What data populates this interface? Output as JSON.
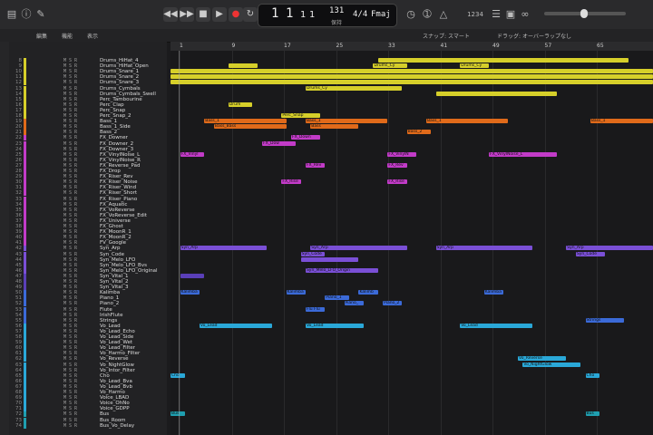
{
  "transport": {
    "bar": "1",
    "beat": "1",
    "div": "1",
    "tick": "1",
    "tempo": "131",
    "tempo_label": "保持",
    "sig": "4/4",
    "key": "Fmaj",
    "lcd_labels": [
      "小節",
      "拍",
      "",
      "",
      "",
      "テンポ",
      "",
      ""
    ],
    "cpu": "1234"
  },
  "toolbar2": {
    "edit": "編集",
    "func": "機能",
    "view": "表示",
    "snap_label": "スナップ:",
    "snap_value": "スマート",
    "drag_label": "ドラッグ:",
    "drag_value": "オーバーラップなし"
  },
  "ruler": [
    "1",
    "9",
    "17",
    "25",
    "33",
    "41",
    "49",
    "57",
    "65"
  ],
  "colors": {
    "yellow": "#d6cf2a",
    "orange": "#e06a1a",
    "magenta": "#c23bc8",
    "purple": "#7a4fd6",
    "violet": "#5a3fb8",
    "blue": "#3b6ad8",
    "cyan": "#2aa8d8",
    "teal": "#1f9fb0"
  },
  "tracks": [
    {
      "n": "8",
      "name": "Drums_HiHat_4",
      "c": "yellow"
    },
    {
      "n": "9",
      "name": "Drums_HiHat_Open",
      "c": "yellow"
    },
    {
      "n": "10",
      "name": "Drums_Snare_1",
      "c": "yellow"
    },
    {
      "n": "11",
      "name": "Drums_Snare_2",
      "c": "yellow"
    },
    {
      "n": "12",
      "name": "Drums_Snare_3",
      "c": "yellow"
    },
    {
      "n": "13",
      "name": "Drums_Cymbals",
      "c": "yellow"
    },
    {
      "n": "14",
      "name": "Drums_Cymbals_Swell",
      "c": "yellow"
    },
    {
      "n": "15",
      "name": "Perc_Tambourine",
      "c": "yellow"
    },
    {
      "n": "16",
      "name": "Perc_Clap",
      "c": "yellow"
    },
    {
      "n": "17",
      "name": "Perc_Snap",
      "c": "yellow"
    },
    {
      "n": "18",
      "name": "Perc_Snap_2",
      "c": "yellow"
    },
    {
      "n": "19",
      "name": "Bass_1",
      "c": "orange"
    },
    {
      "n": "20",
      "name": "Bass_1_Side",
      "c": "orange"
    },
    {
      "n": "21",
      "name": "Bass_2",
      "c": "orange"
    },
    {
      "n": "22",
      "name": "FX_Downer",
      "c": "magenta"
    },
    {
      "n": "23",
      "name": "FX_Downer_2",
      "c": "magenta"
    },
    {
      "n": "24",
      "name": "FX_Downer_3",
      "c": "magenta"
    },
    {
      "n": "25",
      "name": "FX_VinylNoise_L",
      "c": "magenta"
    },
    {
      "n": "26",
      "name": "FX_VinylNoise_R",
      "c": "magenta"
    },
    {
      "n": "27",
      "name": "FX_Reverse_Pad",
      "c": "magenta"
    },
    {
      "n": "28",
      "name": "FX_Drop",
      "c": "magenta"
    },
    {
      "n": "29",
      "name": "FX_Riser_Rev",
      "c": "magenta"
    },
    {
      "n": "30",
      "name": "FX_Riser_Noise",
      "c": "magenta"
    },
    {
      "n": "31",
      "name": "FX_Riser_Wind",
      "c": "magenta"
    },
    {
      "n": "32",
      "name": "FX_Riser_Short",
      "c": "magenta"
    },
    {
      "n": "33",
      "name": "FX_Riser_Piano",
      "c": "magenta"
    },
    {
      "n": "34",
      "name": "FX_Aquatic",
      "c": "magenta"
    },
    {
      "n": "35",
      "name": "FX_VoReverse",
      "c": "magenta"
    },
    {
      "n": "36",
      "name": "FX_VoReverse_Edit",
      "c": "magenta"
    },
    {
      "n": "37",
      "name": "FX_Universe",
      "c": "magenta"
    },
    {
      "n": "38",
      "name": "FX_Ghost",
      "c": "magenta"
    },
    {
      "n": "39",
      "name": "FX_MoonR_1",
      "c": "magenta"
    },
    {
      "n": "40",
      "name": "FX_MoonR_2",
      "c": "magenta"
    },
    {
      "n": "41",
      "name": "FV_Google",
      "c": "magenta"
    },
    {
      "n": "42",
      "name": "Syn_Arp",
      "c": "purple"
    },
    {
      "n": "43",
      "name": "Syn_Code",
      "c": "purple"
    },
    {
      "n": "44",
      "name": "Syn_Melo_LFO",
      "c": "purple"
    },
    {
      "n": "45",
      "name": "Syn_Melo_LFO_Bvs",
      "c": "purple"
    },
    {
      "n": "46",
      "name": "Syn_Melo_LFO_Original",
      "c": "purple"
    },
    {
      "n": "47",
      "name": "Syn_Vital_1",
      "c": "violet"
    },
    {
      "n": "48",
      "name": "Syn_Vital_2",
      "c": "violet"
    },
    {
      "n": "49",
      "name": "Syn_Vital_3",
      "c": "violet"
    },
    {
      "n": "50",
      "name": "Kalimba",
      "c": "blue"
    },
    {
      "n": "51",
      "name": "Piano_1",
      "c": "blue"
    },
    {
      "n": "52",
      "name": "Piano_2",
      "c": "blue"
    },
    {
      "n": "53",
      "name": "Flute",
      "c": "blue"
    },
    {
      "n": "54",
      "name": "IrishFlute",
      "c": "blue"
    },
    {
      "n": "55",
      "name": "Strings",
      "c": "blue"
    },
    {
      "n": "56",
      "name": "Vo_Lead",
      "c": "cyan"
    },
    {
      "n": "57",
      "name": "Vo_Lead_Echo",
      "c": "cyan"
    },
    {
      "n": "58",
      "name": "Vo_Lead_Side",
      "c": "cyan"
    },
    {
      "n": "59",
      "name": "Vo_Lead_Wet",
      "c": "cyan"
    },
    {
      "n": "60",
      "name": "Vo_Lead_Filter",
      "c": "cyan"
    },
    {
      "n": "61",
      "name": "Vo_Harmo_Filter",
      "c": "cyan"
    },
    {
      "n": "62",
      "name": "Vo_Reverse",
      "c": "cyan"
    },
    {
      "n": "63",
      "name": "Vo_NightGlow",
      "c": "cyan"
    },
    {
      "n": "64",
      "name": "Vo_Intor_Filter",
      "c": "cyan"
    },
    {
      "n": "65",
      "name": "Cho",
      "c": "cyan"
    },
    {
      "n": "66",
      "name": "Vo_Lead_Bva",
      "c": "cyan"
    },
    {
      "n": "67",
      "name": "Vo_Lead_Bvb",
      "c": "cyan"
    },
    {
      "n": "68",
      "name": "Vo_Harmo",
      "c": "cyan"
    },
    {
      "n": "69",
      "name": "Voice_LBAD",
      "c": "cyan"
    },
    {
      "n": "70",
      "name": "Voice_OhNo",
      "c": "cyan"
    },
    {
      "n": "71",
      "name": "Voice_GDPP",
      "c": "cyan"
    },
    {
      "n": "72",
      "name": "Bus",
      "c": "teal"
    },
    {
      "n": "73",
      "name": "Bus_Room",
      "c": "teal"
    },
    {
      "n": "74",
      "name": "Bus_Vo_Delay",
      "c": "teal"
    }
  ],
  "regions": [
    {
      "t": 0,
      "x": 0.43,
      "w": 0.52,
      "c": "yellow",
      "l": ""
    },
    {
      "t": 1,
      "x": 0.12,
      "w": 0.06,
      "c": "yellow",
      "l": ""
    },
    {
      "t": 1,
      "x": 0.42,
      "w": 0.07,
      "c": "yellow",
      "l": "Drums_Cy"
    },
    {
      "t": 1,
      "x": 0.6,
      "w": 0.06,
      "c": "yellow",
      "l": "Drums_Cy"
    },
    {
      "t": 2,
      "x": 0.0,
      "w": 1.0,
      "c": "yellow",
      "l": ""
    },
    {
      "t": 3,
      "x": 0.0,
      "w": 1.0,
      "c": "yellow",
      "l": ""
    },
    {
      "t": 4,
      "x": 0.0,
      "w": 1.0,
      "c": "yellow",
      "l": ""
    },
    {
      "t": 5,
      "x": 0.28,
      "w": 0.2,
      "c": "yellow",
      "l": "Drums_Cy"
    },
    {
      "t": 6,
      "x": 0.55,
      "w": 0.25,
      "c": "yellow",
      "l": ""
    },
    {
      "t": 8,
      "x": 0.12,
      "w": 0.05,
      "c": "yellow",
      "l": "Drum"
    },
    {
      "t": 10,
      "x": 0.23,
      "w": 0.08,
      "c": "yellow",
      "l": "Perc_Snap"
    },
    {
      "t": 11,
      "x": 0.07,
      "w": 0.17,
      "c": "orange",
      "l": "Bass_1"
    },
    {
      "t": 11,
      "x": 0.28,
      "w": 0.17,
      "c": "orange",
      "l": "Bass_1"
    },
    {
      "t": 11,
      "x": 0.53,
      "w": 0.17,
      "c": "orange",
      "l": "Bass_1"
    },
    {
      "t": 11,
      "x": 0.87,
      "w": 0.13,
      "c": "orange",
      "l": "Bass_1"
    },
    {
      "t": 12,
      "x": 0.09,
      "w": 0.15,
      "c": "orange",
      "l": "Bass_Bass"
    },
    {
      "t": 12,
      "x": 0.29,
      "w": 0.1,
      "c": "orange",
      "l": "Bass"
    },
    {
      "t": 13,
      "x": 0.49,
      "w": 0.05,
      "c": "orange",
      "l": "Bass_2"
    },
    {
      "t": 14,
      "x": 0.25,
      "w": 0.06,
      "c": "magenta",
      "l": "FX_Down"
    },
    {
      "t": 15,
      "x": 0.19,
      "w": 0.07,
      "c": "magenta",
      "l": "FX_Dow"
    },
    {
      "t": 17,
      "x": 0.02,
      "w": 0.05,
      "c": "magenta",
      "l": "FX_Vinyl"
    },
    {
      "t": 17,
      "x": 0.45,
      "w": 0.06,
      "c": "magenta",
      "l": "FX_VinylN"
    },
    {
      "t": 17,
      "x": 0.66,
      "w": 0.14,
      "c": "magenta",
      "l": "FX_VinylNoise_L"
    },
    {
      "t": 19,
      "x": 0.28,
      "w": 0.04,
      "c": "magenta",
      "l": "FX_Rev"
    },
    {
      "t": 19,
      "x": 0.45,
      "w": 0.04,
      "c": "magenta",
      "l": "FX_Rev"
    },
    {
      "t": 22,
      "x": 0.23,
      "w": 0.04,
      "c": "magenta",
      "l": "FX_Rise"
    },
    {
      "t": 22,
      "x": 0.45,
      "w": 0.04,
      "c": "magenta",
      "l": "FX_Rise"
    },
    {
      "t": 34,
      "x": 0.02,
      "w": 0.18,
      "c": "purple",
      "l": "Syn_Arp"
    },
    {
      "t": 34,
      "x": 0.29,
      "w": 0.2,
      "c": "purple",
      "l": "Syn_Arp"
    },
    {
      "t": 34,
      "x": 0.55,
      "w": 0.2,
      "c": "purple",
      "l": "Syn_Arp"
    },
    {
      "t": 34,
      "x": 0.82,
      "w": 0.18,
      "c": "purple",
      "l": "Syn_Arp"
    },
    {
      "t": 35,
      "x": 0.27,
      "w": 0.05,
      "c": "purple",
      "l": "Syn_Code"
    },
    {
      "t": 35,
      "x": 0.84,
      "w": 0.06,
      "c": "purple",
      "l": "Syn_Code"
    },
    {
      "t": 36,
      "x": 0.27,
      "w": 0.12,
      "c": "purple",
      "l": ""
    },
    {
      "t": 38,
      "x": 0.28,
      "w": 0.15,
      "c": "purple",
      "l": "Syn_Melo_LFO_Origin"
    },
    {
      "t": 39,
      "x": 0.02,
      "w": 0.05,
      "c": "violet",
      "l": ""
    },
    {
      "t": 42,
      "x": 0.02,
      "w": 0.04,
      "c": "blue",
      "l": "Kalimba"
    },
    {
      "t": 42,
      "x": 0.24,
      "w": 0.04,
      "c": "blue",
      "l": "Kalimba"
    },
    {
      "t": 42,
      "x": 0.39,
      "w": 0.04,
      "c": "blue",
      "l": "Kalimb"
    },
    {
      "t": 42,
      "x": 0.65,
      "w": 0.04,
      "c": "blue",
      "l": "Kalimba"
    },
    {
      "t": 43,
      "x": 0.32,
      "w": 0.05,
      "c": "blue",
      "l": "Piano_1"
    },
    {
      "t": 44,
      "x": 0.36,
      "w": 0.04,
      "c": "blue",
      "l": "Piano_"
    },
    {
      "t": 44,
      "x": 0.44,
      "w": 0.04,
      "c": "blue",
      "l": "Piano_2"
    },
    {
      "t": 45,
      "x": 0.28,
      "w": 0.04,
      "c": "blue",
      "l": "Flu Flu"
    },
    {
      "t": 47,
      "x": 0.86,
      "w": 0.08,
      "c": "blue",
      "l": "Strings"
    },
    {
      "t": 48,
      "x": 0.06,
      "w": 0.15,
      "c": "cyan",
      "l": "Vo_Lead"
    },
    {
      "t": 48,
      "x": 0.28,
      "w": 0.12,
      "c": "cyan",
      "l": "Vo_Lead"
    },
    {
      "t": 48,
      "x": 0.6,
      "w": 0.15,
      "c": "cyan",
      "l": "Vo_Lead"
    },
    {
      "t": 54,
      "x": 0.72,
      "w": 0.1,
      "c": "cyan",
      "l": "Vo_Reverse"
    },
    {
      "t": 55,
      "x": 0.73,
      "w": 0.12,
      "c": "cyan",
      "l": "Vo_NightGlow"
    },
    {
      "t": 57,
      "x": 0.0,
      "w": 0.03,
      "c": "cyan",
      "l": "Cho"
    },
    {
      "t": 57,
      "x": 0.86,
      "w": 0.03,
      "c": "cyan",
      "l": "Cho"
    },
    {
      "t": 64,
      "x": 0.0,
      "w": 0.03,
      "c": "teal",
      "l": "Bus"
    },
    {
      "t": 64,
      "x": 0.86,
      "w": 0.03,
      "c": "teal",
      "l": "Bus"
    }
  ]
}
